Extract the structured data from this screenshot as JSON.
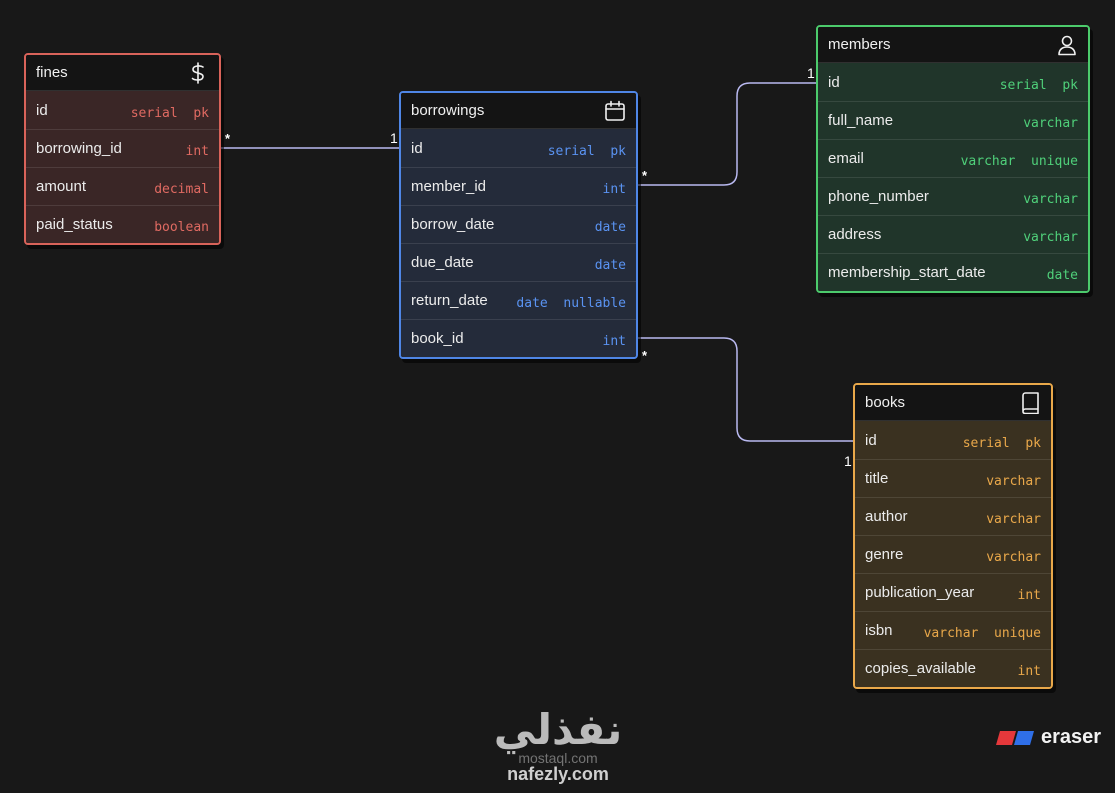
{
  "tables": {
    "fines": {
      "title": "fines",
      "icon": "dollar-icon",
      "color": "#d9635a",
      "fields": [
        {
          "name": "id",
          "type": "serial  pk"
        },
        {
          "name": "borrowing_id",
          "type": "int"
        },
        {
          "name": "amount",
          "type": "decimal"
        },
        {
          "name": "paid_status",
          "type": "boolean"
        }
      ]
    },
    "borrowings": {
      "title": "borrowings",
      "icon": "calendar-icon",
      "color": "#4f86e6",
      "fields": [
        {
          "name": "id",
          "type": "serial  pk"
        },
        {
          "name": "member_id",
          "type": "int"
        },
        {
          "name": "borrow_date",
          "type": "date"
        },
        {
          "name": "due_date",
          "type": "date"
        },
        {
          "name": "return_date",
          "type": "date  nullable"
        },
        {
          "name": "book_id",
          "type": "int"
        }
      ]
    },
    "members": {
      "title": "members",
      "icon": "user-icon",
      "color": "#4ccb6c",
      "fields": [
        {
          "name": "id",
          "type": "serial  pk"
        },
        {
          "name": "full_name",
          "type": "varchar"
        },
        {
          "name": "email",
          "type": "varchar  unique"
        },
        {
          "name": "phone_number",
          "type": "varchar"
        },
        {
          "name": "address",
          "type": "varchar"
        },
        {
          "name": "membership_start_date",
          "type": "date"
        }
      ]
    },
    "books": {
      "title": "books",
      "icon": "book-icon",
      "color": "#e9a84a",
      "fields": [
        {
          "name": "id",
          "type": "serial  pk"
        },
        {
          "name": "title",
          "type": "varchar"
        },
        {
          "name": "author",
          "type": "varchar"
        },
        {
          "name": "genre",
          "type": "varchar"
        },
        {
          "name": "publication_year",
          "type": "int"
        },
        {
          "name": "isbn",
          "type": "varchar  unique"
        },
        {
          "name": "copies_available",
          "type": "int"
        }
      ]
    }
  },
  "relations": [
    {
      "from": "fines.borrowing_id",
      "to": "borrowings.id",
      "from_card": "*",
      "to_card": "1"
    },
    {
      "from": "borrowings.member_id",
      "to": "members.id",
      "from_card": "*",
      "to_card": "1"
    },
    {
      "from": "borrowings.book_id",
      "to": "books.id",
      "from_card": "*",
      "to_card": "1"
    }
  ],
  "watermark": {
    "arabic": "نفذلي",
    "url_faint": "mostaql.com",
    "url": "nafezly.com"
  },
  "brand": {
    "name": "eraser",
    "colors": [
      "#e5383b",
      "#2f6fe8"
    ]
  },
  "connector_color": "#b9b9f0"
}
